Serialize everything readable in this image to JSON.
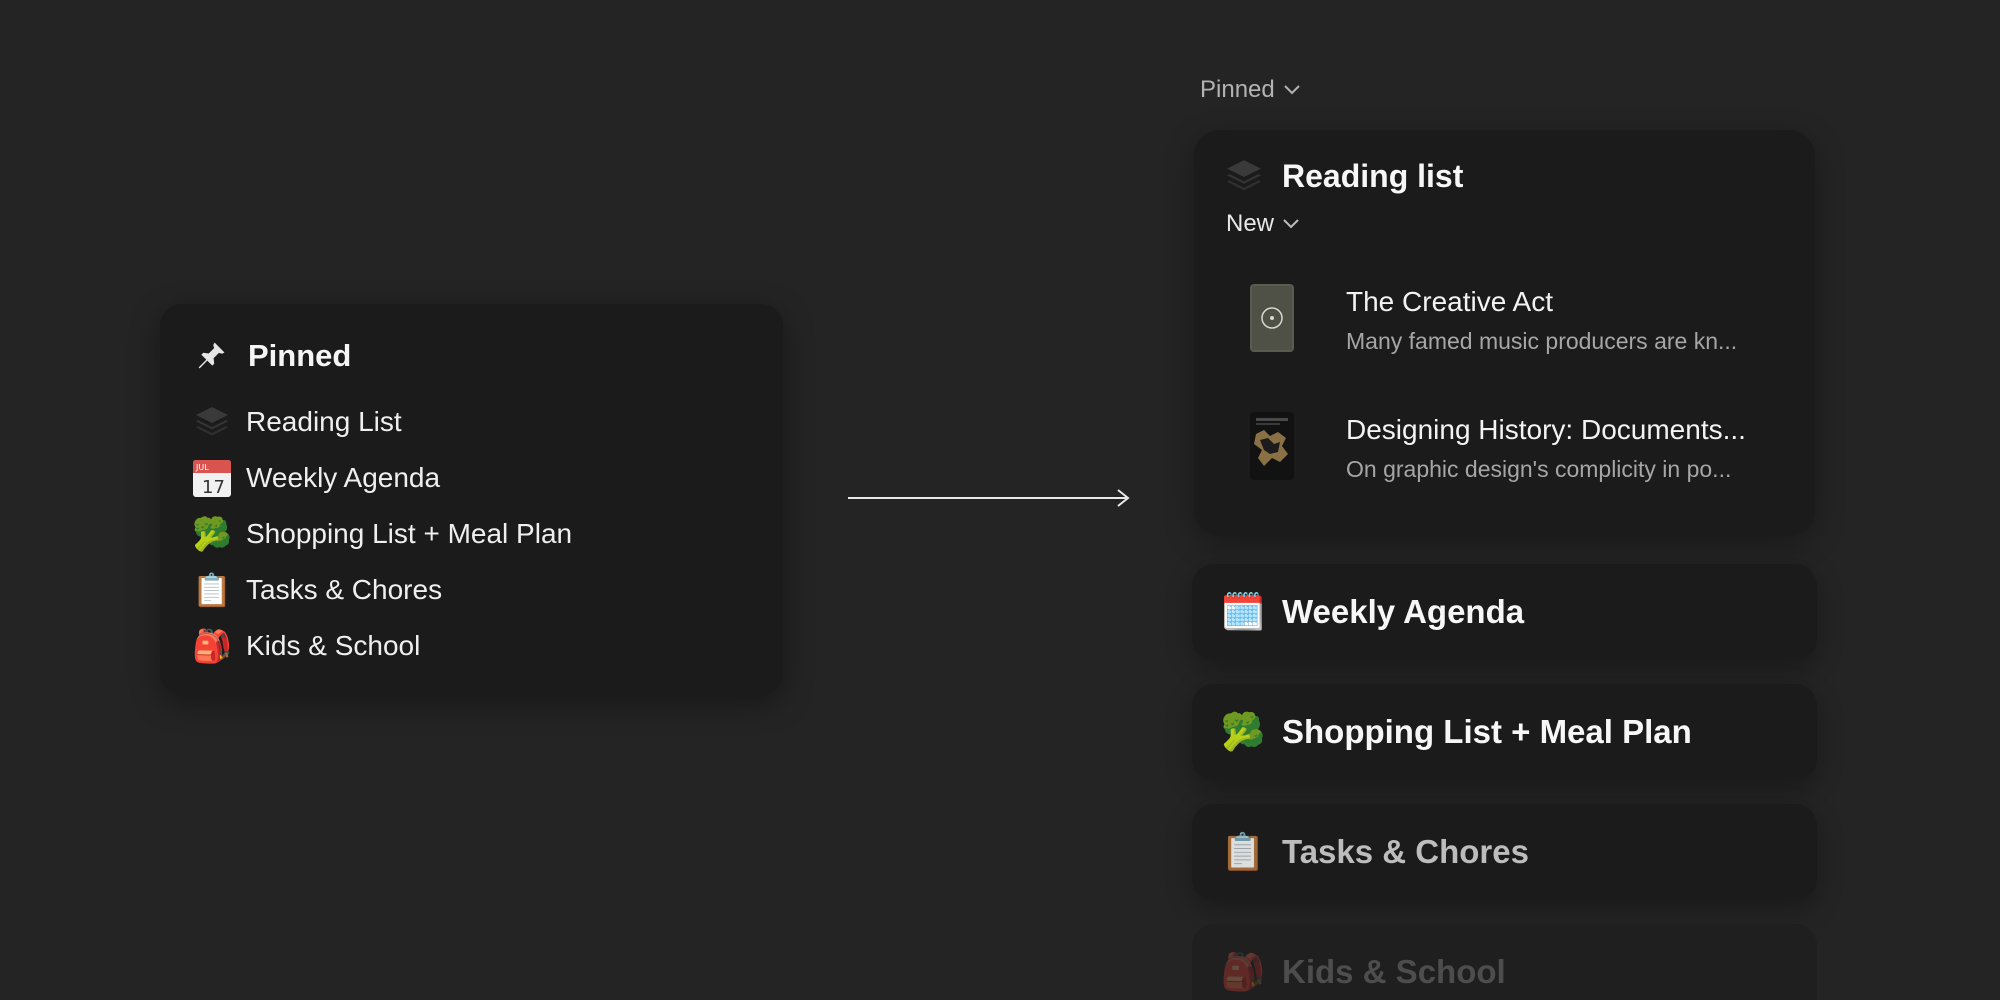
{
  "left_card": {
    "title": "Pinned",
    "items": [
      {
        "label": "Reading List",
        "icon": "stack-icon"
      },
      {
        "label": "Weekly Agenda",
        "icon": "calendar-icon",
        "calendar_month": "JUL",
        "calendar_day": "17"
      },
      {
        "label": "Shopping List + Meal Plan",
        "icon": "broccoli-icon",
        "glyph": "🥦"
      },
      {
        "label": "Tasks & Chores",
        "icon": "clipboard-icon",
        "glyph": "📋"
      },
      {
        "label": "Kids & School",
        "icon": "backpack-icon",
        "glyph": "🎒"
      }
    ]
  },
  "right_panel": {
    "section_label": "Pinned",
    "reading_card": {
      "title": "Reading list",
      "filter_label": "New",
      "books": [
        {
          "title": "The Creative Act",
          "description": "Many famed music producers are kn...",
          "cover": "creative-act-cover"
        },
        {
          "title": "Designing History: Documents...",
          "description": "On graphic design's complicity in po...",
          "cover": "designing-history-cover"
        }
      ]
    },
    "cards": [
      {
        "label": "Weekly Agenda",
        "icon": "spiral-calendar-icon",
        "glyph": "🗓️"
      },
      {
        "label": "Shopping List + Meal Plan",
        "icon": "broccoli-icon",
        "glyph": "🥦"
      },
      {
        "label": "Tasks & Chores",
        "icon": "clipboard-icon",
        "glyph": "📋"
      },
      {
        "label": "Kids & School",
        "icon": "backpack-icon",
        "glyph": "🎒"
      }
    ]
  },
  "colors": {
    "background": "#242424",
    "card": "#1b1b1b",
    "text": "#f2f2f2",
    "muted_text": "#a6a6a6"
  }
}
